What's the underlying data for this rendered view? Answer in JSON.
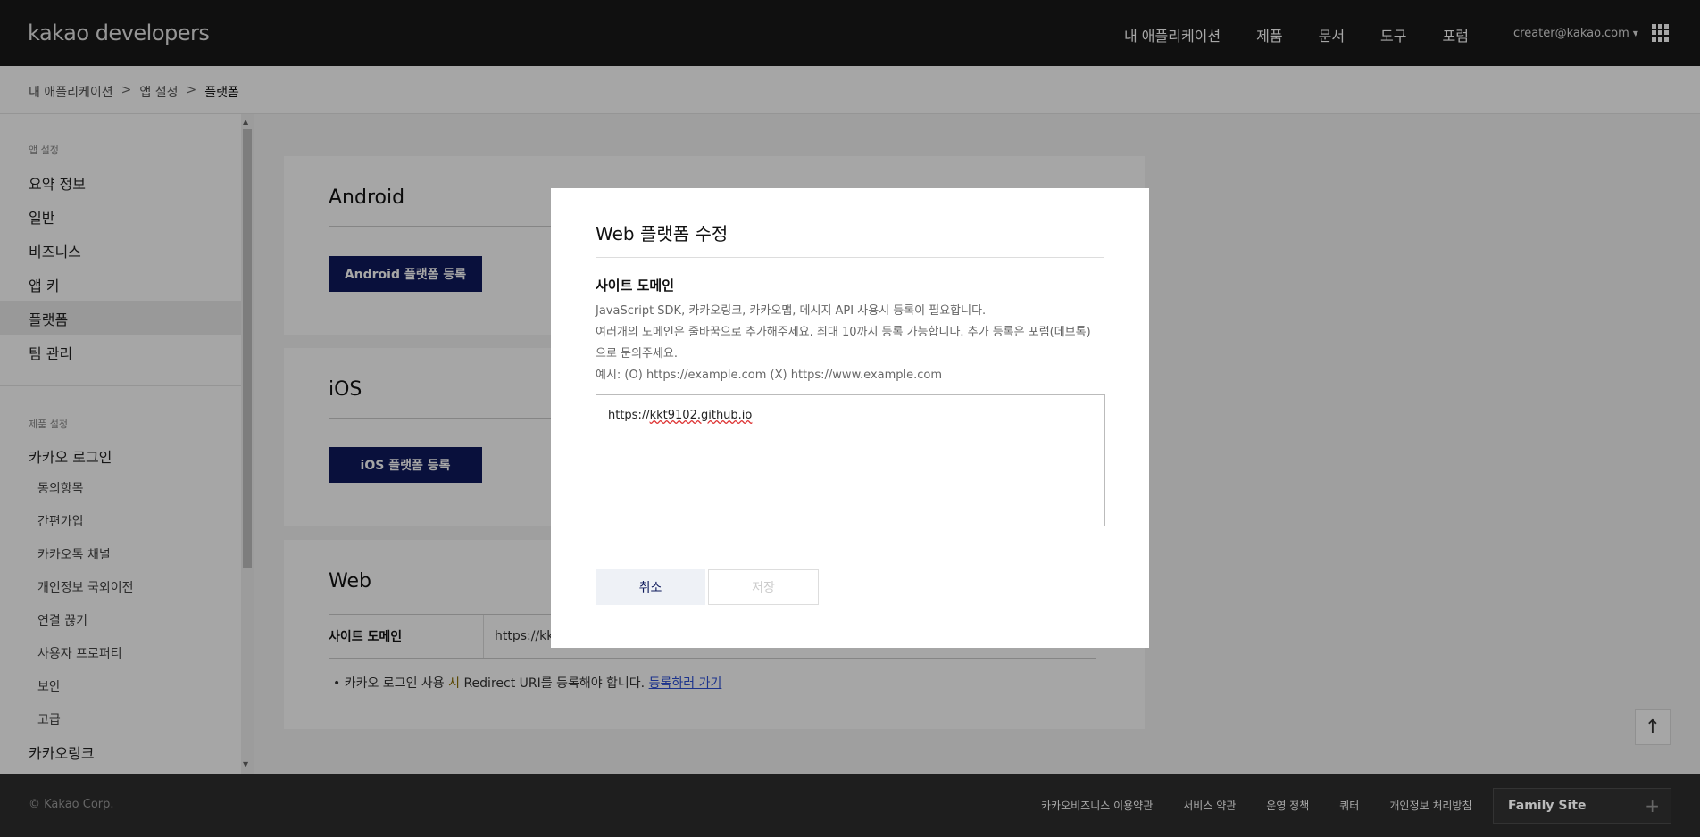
{
  "header": {
    "logo_bold": "kakao",
    "logo_light": " developers",
    "nav": [
      "내 애플리케이션",
      "제품",
      "문서",
      "도구",
      "포럼"
    ],
    "account": "creater@kakao.com",
    "apps_icon": "grid-icon"
  },
  "breadcrumb": [
    "내 애플리케이션",
    "앱 설정",
    "플랫폼"
  ],
  "sidebar": {
    "group_app": "앱 설정",
    "app_items": [
      "요약 정보",
      "일반",
      "비즈니스",
      "앱 키",
      "플랫폼",
      "팀 관리"
    ],
    "active": "플랫폼",
    "group_product": "제품 설정",
    "product_main": "카카오 로그인",
    "product_subs": [
      "동의항목",
      "간편가입",
      "카카오톡 채널",
      "개인정보 국외이전",
      "연결 끊기",
      "사용자 프로퍼티",
      "보안",
      "고급"
    ],
    "product_next": "카카오링크"
  },
  "cards": {
    "android_title": "Android",
    "android_button": "Android 플랫폼 등록",
    "ios_title": "iOS",
    "ios_button": "iOS 플랫폼 등록",
    "web_title": "Web",
    "web_th": "사이트 도메인",
    "web_td": "https://kk",
    "web_note_pre": "카카오 로그인 사용 ",
    "web_note_hl": "시",
    "web_note_post": " Redirect URI를 등록해야 합니다.",
    "web_note_link": "등록하러 가기"
  },
  "modal": {
    "title": "Web 플랫폼 수정",
    "field_label": "사이트 도메인",
    "desc_lines": [
      "JavaScript SDK, 카카오링크, 카카오맵, 메시지 API 사용시 등록이 필요합니다.",
      "여러개의 도메인은 줄바꿈으로 추가해주세요. 최대 10까지 등록 가능합니다. 추가 등록은 포럼(데브톡)",
      "으로 문의주세요.",
      "예시: (O) https://example.com (X) https://www.example.com"
    ],
    "textarea_value_pre": "https://",
    "textarea_value_spell": "kkt9102.github.io",
    "cancel_label": "취소",
    "save_label": "저장"
  },
  "footer": {
    "copyright": "© Kakao Corp.",
    "links": [
      "카카오비즈니스 이용약관",
      "서비스 약관",
      "운영 정책",
      "쿼터",
      "개인정보 처리방침"
    ],
    "family_site": "Family Site"
  }
}
